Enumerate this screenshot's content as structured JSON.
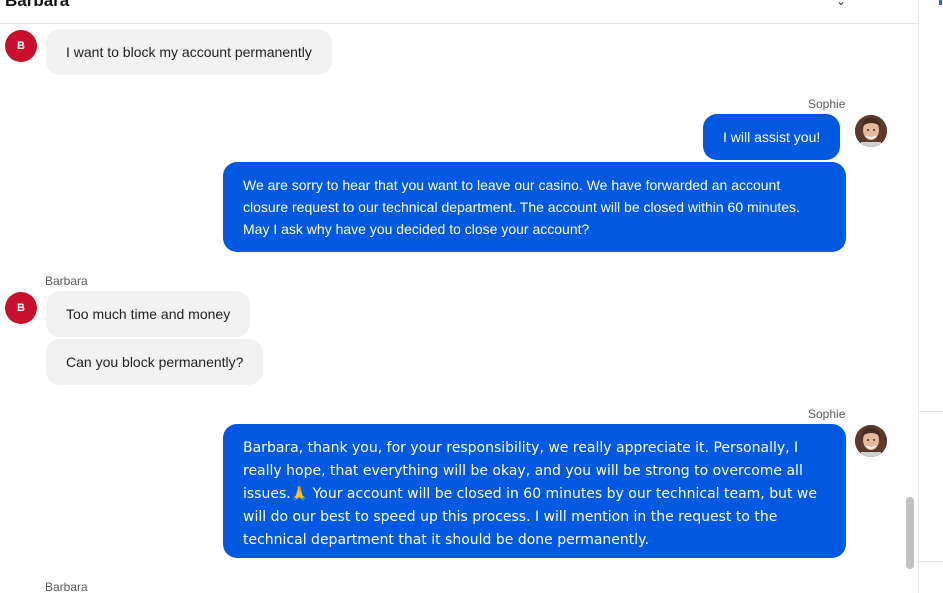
{
  "header": {
    "contact_name": "Barbara",
    "icon": "chevron-icon"
  },
  "messages": [
    {
      "sender": "Barbara",
      "avatar_letter": "B",
      "text": "I want to block my account permanently"
    },
    {
      "sender": "Sophie",
      "text": "I will assist you!"
    },
    {
      "sender": "Sophie",
      "text": "We are sorry to hear that you want to leave our casino. We have forwarded an account closure request to our technical department. The account will be closed within 60 minutes. May I ask why have you decided to close your account?"
    },
    {
      "sender": "Barbara",
      "avatar_letter": "B",
      "text": "Too much time and money"
    },
    {
      "sender": "Barbara",
      "text": "Can you block permanently?"
    },
    {
      "sender": "Sophie",
      "text": "Barbara, thank you, for your responsibility, we really appreciate it. Personally, I really hope, that everything will be okay, and you will be strong to overcome all issues.🙏 Your account will be closed in 60 minutes by our technical team, but we will do our best to speed up this process. I will mention in the request to the technical department that it should be done permanently."
    }
  ],
  "labels": {
    "sophie_1": "Sophie",
    "barbara_1": "Barbara",
    "sophie_2": "Sophie",
    "barbara_2": "Barbara"
  },
  "colors": {
    "agent_bubble": "#0059e0",
    "customer_bubble": "#f2f2f2",
    "customer_avatar": "#c8102e"
  }
}
